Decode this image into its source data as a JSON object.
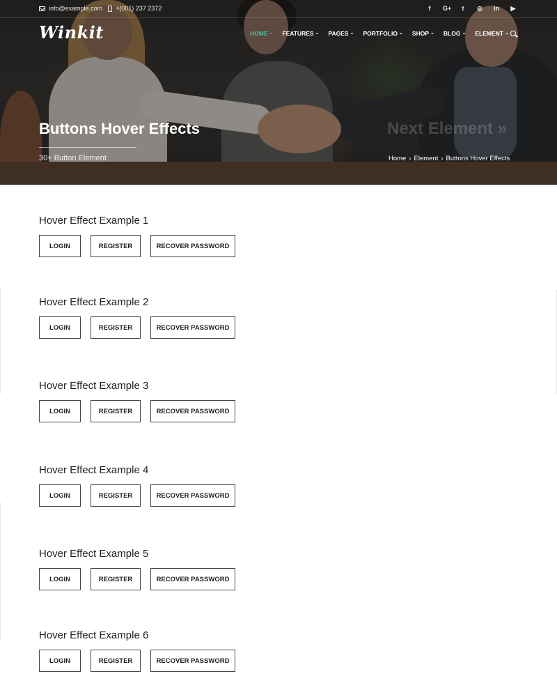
{
  "topbar": {
    "email": "info@example.com",
    "phone": "+(001) 237 2372",
    "socials": [
      "f",
      "G+",
      "t",
      "◎",
      "in",
      "▶"
    ]
  },
  "brand": {
    "logo": "Winkit"
  },
  "nav": {
    "items": [
      {
        "label": "HOME",
        "active": true
      },
      {
        "label": "FEATURES"
      },
      {
        "label": "PAGES"
      },
      {
        "label": "PORTFOLIO"
      },
      {
        "label": "SHOP"
      },
      {
        "label": "BLOG"
      },
      {
        "label": "ELEMENT"
      }
    ],
    "accent": "#49c1a5"
  },
  "hero": {
    "title": "Buttons Hover Effects",
    "subtitle": "30+ Button Element",
    "next_label": "Next Element »",
    "breadcrumb": [
      "Home",
      "Element",
      "Buttons Hover Effects"
    ]
  },
  "sections": [
    {
      "title": "Hover Effect Example 1",
      "buttons": [
        "LOGIN",
        "REGISTER",
        "RECOVER PASSWORD"
      ]
    },
    {
      "title": "Hover Effect Example 2",
      "buttons": [
        "LOGIN",
        "REGISTER",
        "RECOVER PASSWORD"
      ]
    },
    {
      "title": "Hover Effect Example 3",
      "buttons": [
        "LOGIN",
        "REGISTER",
        "RECOVER PASSWORD"
      ]
    },
    {
      "title": "Hover Effect Example 4",
      "buttons": [
        "LOGIN",
        "REGISTER",
        "RECOVER PASSWORD"
      ]
    },
    {
      "title": "Hover Effect Example 5",
      "buttons": [
        "LOGIN",
        "REGISTER",
        "RECOVER PASSWORD"
      ]
    },
    {
      "title": "Hover Effect Example 6",
      "buttons": [
        "LOGIN",
        "REGISTER",
        "RECOVER PASSWORD"
      ]
    }
  ]
}
